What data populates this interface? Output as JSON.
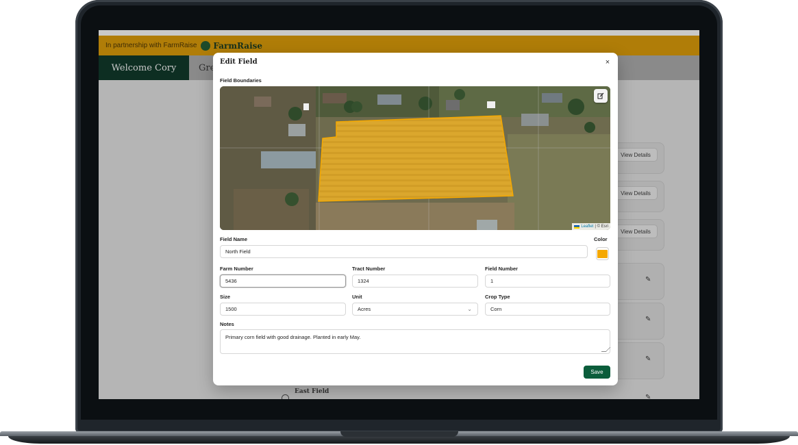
{
  "partner": {
    "text": "In partnership with FarmRaise",
    "brand": "FarmRaise"
  },
  "nav": {
    "welcome": "Welcome Cory",
    "next_tab": "Gre"
  },
  "background_list": {
    "view_details": "View Details",
    "east_field": "East Field"
  },
  "modal": {
    "title": "Edit Field",
    "close_icon": "×",
    "map": {
      "section_label": "Field Boundaries",
      "attribution_leaflet": "Leaflet",
      "attribution_rest": "| © Esri"
    },
    "fields": {
      "field_name": {
        "label": "Field Name",
        "value": "North Field"
      },
      "color": {
        "label": "Color",
        "value": "#f5a800"
      },
      "farm_number": {
        "label": "Farm Number",
        "value": "5436"
      },
      "tract_number": {
        "label": "Tract Number",
        "value": "1324"
      },
      "field_number": {
        "label": "Field Number",
        "value": "1"
      },
      "size": {
        "label": "Size",
        "value": "1500"
      },
      "unit": {
        "label": "Unit",
        "value": "Acres"
      },
      "crop_type": {
        "label": "Crop Type",
        "value": "Corn"
      },
      "notes": {
        "label": "Notes",
        "value": "Primary corn field with good drainage. Planted in early May."
      }
    },
    "save_label": "Save"
  },
  "colors": {
    "brand_green": "#0d3d2c",
    "partner_gold": "#b07d08",
    "save_button": "#0b5d3b",
    "field_fill": "#e8b230"
  }
}
